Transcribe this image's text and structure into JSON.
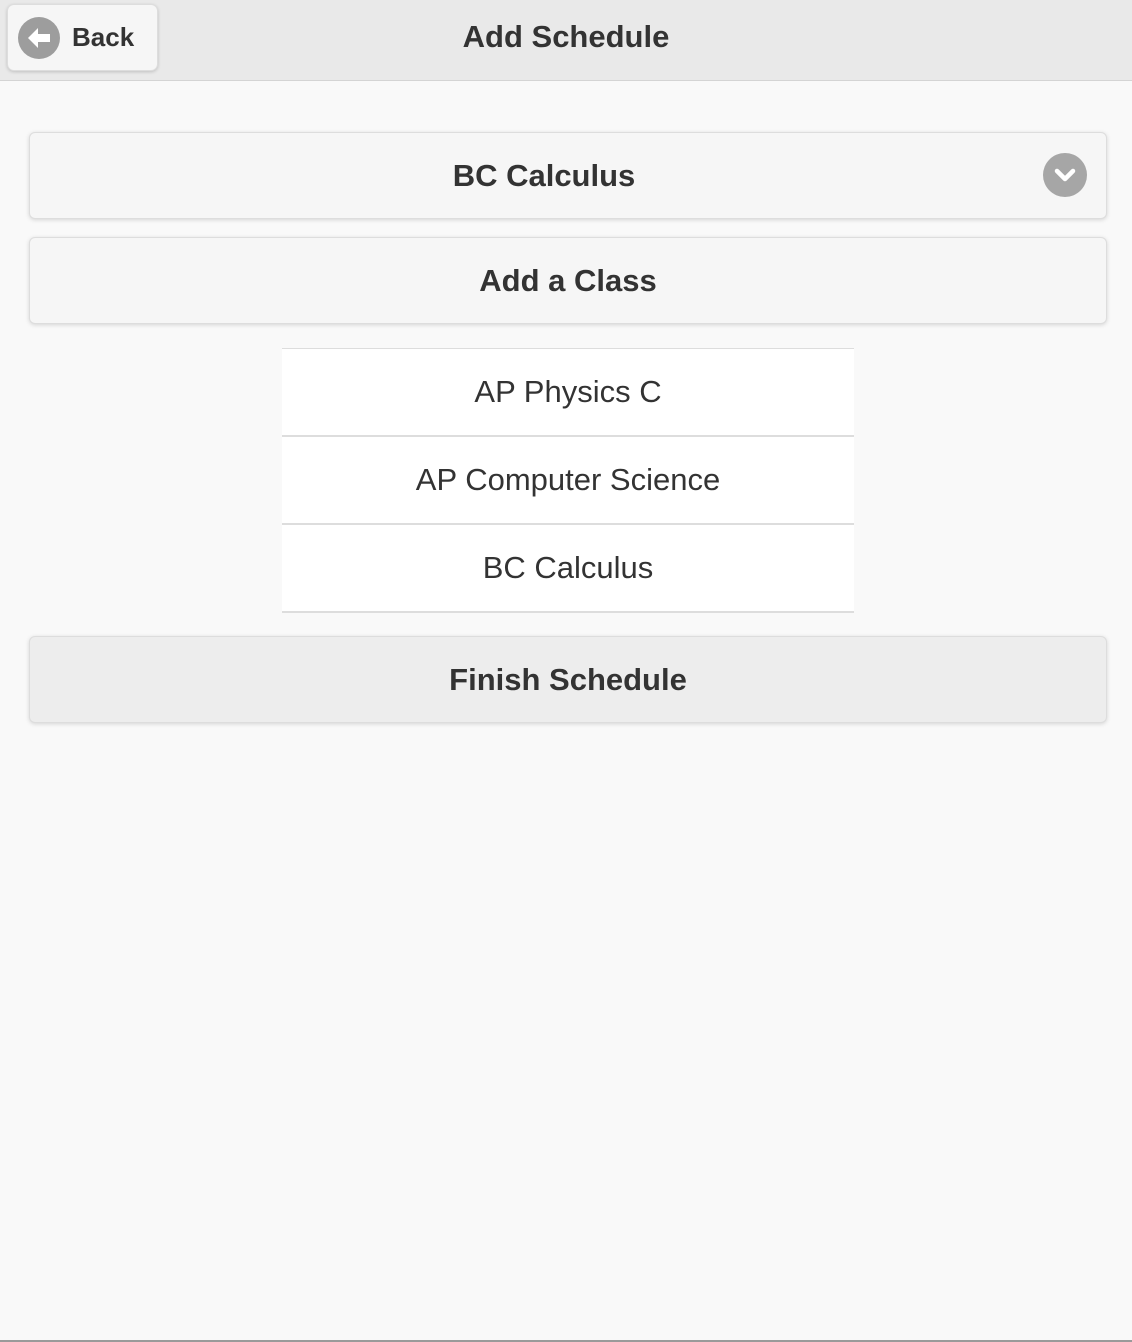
{
  "header": {
    "back_label": "Back",
    "title": "Add Schedule"
  },
  "class_select": {
    "selected": "BC Calculus"
  },
  "add_class_label": "Add a Class",
  "classes": [
    {
      "name": "AP Physics C"
    },
    {
      "name": "AP Computer Science"
    },
    {
      "name": "BC Calculus"
    }
  ],
  "finish_label": "Finish Schedule",
  "icons": {
    "back": "arrow-left-circle-icon",
    "select": "chevron-down-circle-icon"
  },
  "colors": {
    "background": "#f9f9f9",
    "header": "#e9e9e9",
    "icon_disc": "#a6a6a6",
    "text": "#333333"
  }
}
